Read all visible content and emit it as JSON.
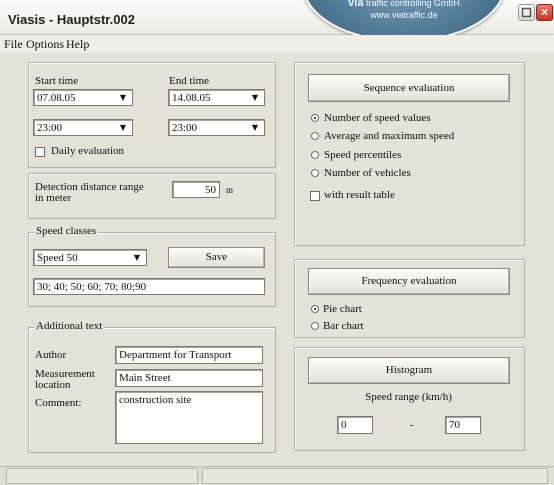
{
  "window": {
    "title": "Viasis - Hauptstr.002",
    "banner_brand": "via",
    "banner_company": "traffic controlling GmbH",
    "banner_url": "www.viatraffic.de",
    "close_glyph": "×"
  },
  "menu": {
    "file": "File",
    "options": "Options",
    "help": "Help"
  },
  "time": {
    "start_label": "Start time",
    "end_label": "End time",
    "start_date": "07.08.05",
    "end_date": "14.08.05",
    "start_hour": "23:00",
    "end_hour": "23:00",
    "daily_label": "Daily evaluation",
    "daily_checked": false
  },
  "detection": {
    "label_line1": "Detection distance range",
    "label_line2": "in meter",
    "value": "50",
    "unit": "m"
  },
  "speed_classes": {
    "legend": "Speed classes",
    "selected": "Speed 50",
    "save_label": "Save",
    "values": "30; 40; 50; 60; 70; 80;90"
  },
  "additional": {
    "legend": "Additional text",
    "author_label": "Author",
    "author_value": "Department for Transport",
    "location_label_line1": "Measurement",
    "location_label_line2": "location",
    "location_value": "Main Street",
    "comment_label": "Comment:",
    "comment_value": "construction site"
  },
  "sequence": {
    "button": "Sequence evaluation",
    "options": [
      "Number of speed values",
      "Average and maximum speed",
      "Speed percentiles",
      "Number of vehicles"
    ],
    "selected_index": 0,
    "result_table_label": "with result table",
    "result_table_checked": false
  },
  "frequency": {
    "button": "Frequency evaluation",
    "options": [
      "Pie chart",
      "Bar chart"
    ],
    "selected_index": 0
  },
  "histogram": {
    "button": "Histogram",
    "range_label": "Speed range (km/h)",
    "from": "0",
    "separator": "-",
    "to": "70"
  },
  "icons": {
    "dropdown": "chevron-down-icon",
    "close": "close-icon",
    "maximize": "maximize-icon"
  }
}
